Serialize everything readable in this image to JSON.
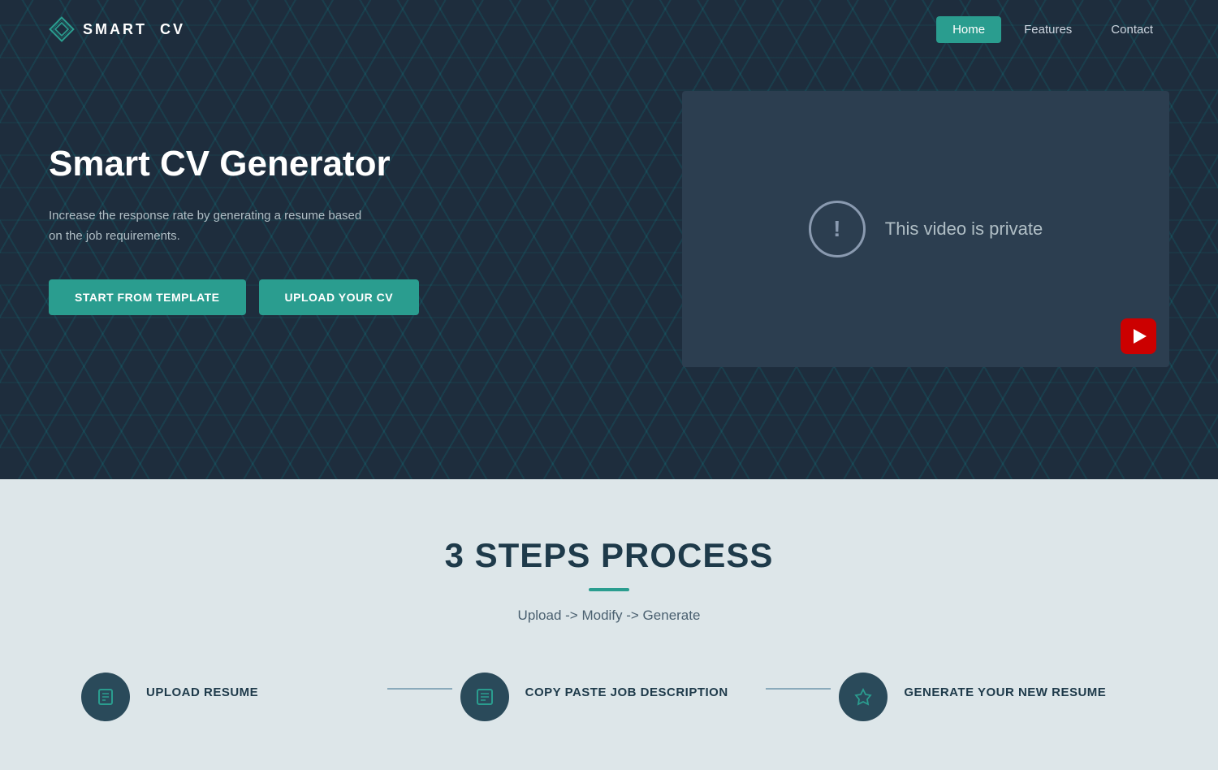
{
  "nav": {
    "logo_text": "SMART",
    "logo_text2": "CV",
    "links": [
      {
        "label": "Home",
        "active": true
      },
      {
        "label": "Features",
        "active": false
      },
      {
        "label": "Contact",
        "active": false
      }
    ]
  },
  "hero": {
    "title": "Smart CV Generator",
    "subtitle": "Increase the response rate by generating a resume based on the job requirements.",
    "btn_template": "START FROM TEMPLATE",
    "btn_upload": "UPLOAD YOUR CV",
    "video_private_label": "This video is private"
  },
  "steps": {
    "title": "3 STEPS PROCESS",
    "subtitle": "Upload -> Modify -> Generate",
    "items": [
      {
        "label": "UPLOAD RESUME",
        "icon": "⬆"
      },
      {
        "label": "COPY PASTE JOB DESCRIPTION",
        "icon": "📋"
      },
      {
        "label": "GENERATE YOUR NEW RESUME",
        "icon": "⚡"
      }
    ]
  }
}
